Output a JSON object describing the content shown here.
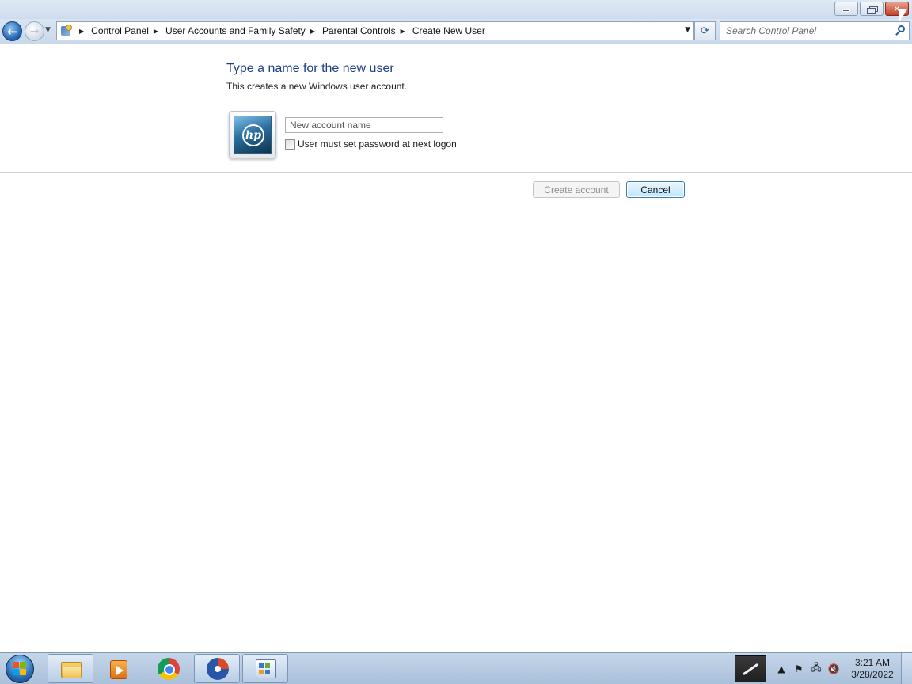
{
  "window": {
    "minimize_glyph": "",
    "close_glyph": "✕"
  },
  "nav": {
    "back_glyph": "←",
    "forward_glyph": "→",
    "dropdown_glyph": "▼",
    "breadcrumbs": [
      {
        "label": "Control Panel"
      },
      {
        "label": "User Accounts and Family Safety"
      },
      {
        "label": "Parental Controls"
      },
      {
        "label": "Create New User"
      }
    ],
    "crumb_separator": "▶",
    "refresh_glyph": "⟳",
    "search_placeholder": "Search Control Panel"
  },
  "content": {
    "heading": "Type a name for the new user",
    "subtext": "This creates a new Windows user account.",
    "avatar_logo_text": "hp",
    "name_input_placeholder": "New account name",
    "name_input_value": "",
    "checkbox_label": "User must set password at next logon",
    "checkbox_checked": false,
    "create_button": "Create account",
    "cancel_button": "Cancel"
  },
  "taskbar": {
    "apps": [
      {
        "name": "windows-explorer",
        "icon": "folder-icon"
      },
      {
        "name": "media-player",
        "icon": "media-player-icon"
      },
      {
        "name": "google-chrome",
        "icon": "chrome-icon"
      },
      {
        "name": "pie-app",
        "icon": "pie-app-icon"
      },
      {
        "name": "control-panel",
        "icon": "control-panel-icon"
      }
    ],
    "tray": {
      "show_hidden_glyph": "▲",
      "flag_glyph": "⚑",
      "network_glyph": "🖧",
      "volume_glyph": "🔇"
    },
    "clock_time": "3:21 AM",
    "clock_date": "3/28/2022"
  },
  "colors": {
    "heading": "#1d3f86",
    "cancel_border": "#3c7fb1",
    "disabled_text": "#8d8d8d"
  }
}
